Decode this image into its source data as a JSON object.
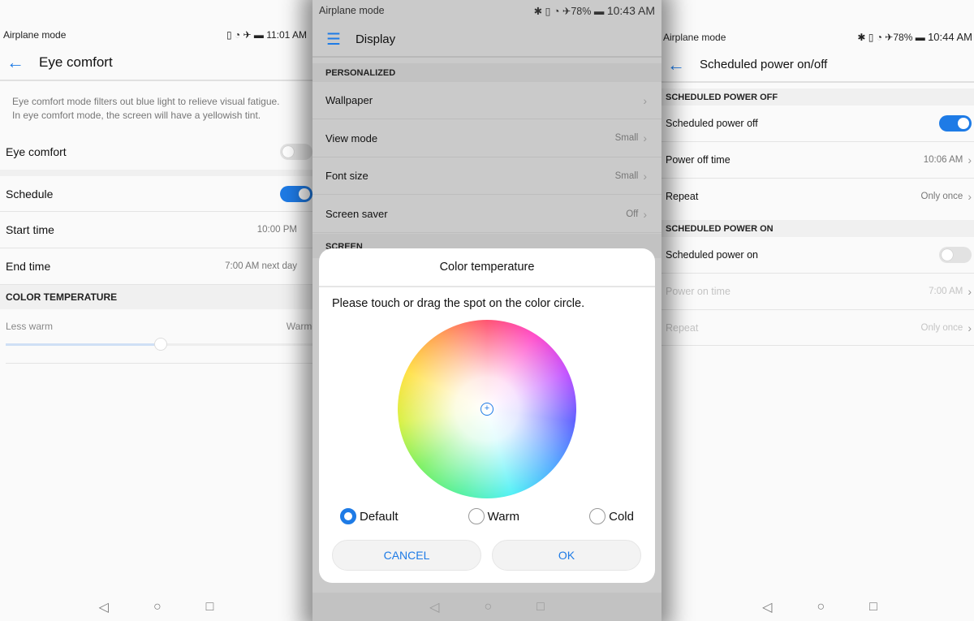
{
  "left": {
    "status": {
      "carrier": "Airplane mode",
      "time": "11:01 AM"
    },
    "title": "Eye comfort",
    "description": [
      "Eye comfort mode filters out blue light to relieve visual fatigue.",
      "In eye comfort mode, the screen will have a yellowish tint."
    ],
    "eye_comfort": {
      "label": "Eye comfort",
      "on": false
    },
    "schedule": {
      "label": "Schedule",
      "on": true
    },
    "start_time": {
      "label": "Start time",
      "value": "10:00 PM"
    },
    "end_time": {
      "label": "End time",
      "value": "7:00 AM next day"
    },
    "section": "COLOR TEMPERATURE",
    "slider": {
      "min_label": "Less warm",
      "max_label": "Warmer",
      "value_percent": 50
    }
  },
  "middle": {
    "status": {
      "carrier": "Airplane mode",
      "battery": "78%",
      "time": "10:43 AM"
    },
    "title": "Display",
    "section": "PERSONALIZED",
    "rows": [
      {
        "label": "Wallpaper",
        "value": ""
      },
      {
        "label": "View mode",
        "value": "Small"
      },
      {
        "label": "Font size",
        "value": "Small"
      },
      {
        "label": "Screen saver",
        "value": "Off"
      }
    ],
    "section2": "SCREEN",
    "dialog": {
      "title": "Color temperature",
      "instruction": "Please touch or drag the spot on the color circle.",
      "options": [
        {
          "label": "Default",
          "selected": true
        },
        {
          "label": "Warm",
          "selected": false
        },
        {
          "label": "Cold",
          "selected": false
        }
      ],
      "cancel": "CANCEL",
      "ok": "OK"
    }
  },
  "right": {
    "status": {
      "carrier": "Airplane mode",
      "battery": "78%",
      "time": "10:44 AM"
    },
    "title": "Scheduled power on/off",
    "off_section": "SCHEDULED POWER OFF",
    "power_off": {
      "label": "Scheduled power off",
      "on": true
    },
    "power_off_time": {
      "label": "Power off time",
      "value": "10:06 AM"
    },
    "repeat_off": {
      "label": "Repeat",
      "value": "Only once"
    },
    "on_section": "SCHEDULED POWER ON",
    "power_on": {
      "label": "Scheduled power on",
      "on": false
    },
    "power_on_time": {
      "label": "Power on time",
      "value": "7:00 AM"
    },
    "repeat_on": {
      "label": "Repeat",
      "value": "Only once"
    }
  },
  "colors": {
    "accent": "#1e7be6"
  }
}
